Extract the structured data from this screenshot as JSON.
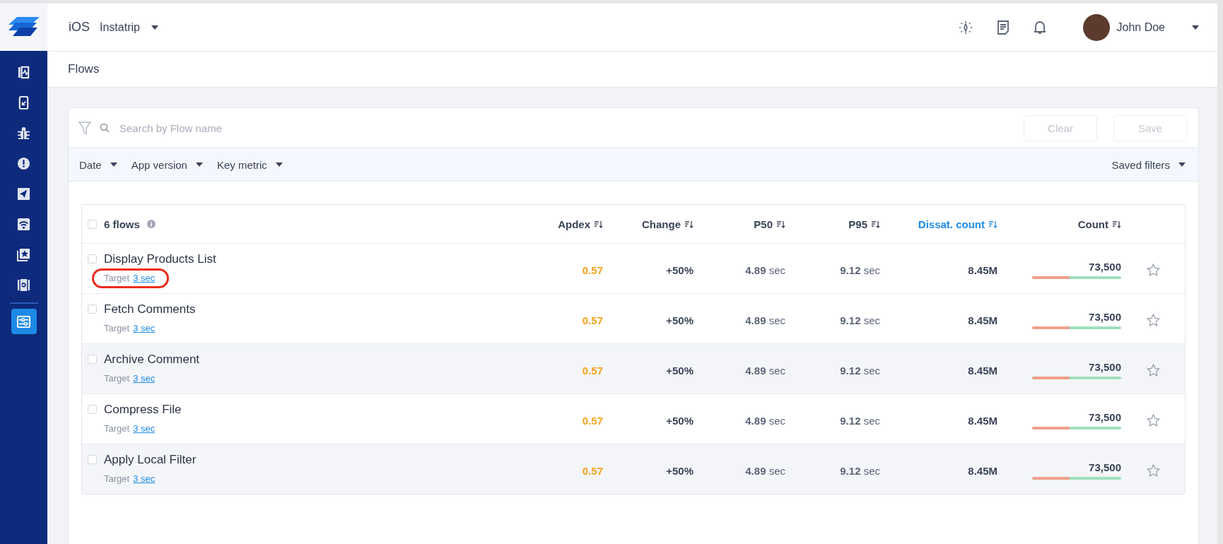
{
  "app": {
    "platform": "iOS",
    "name": "Instatrip"
  },
  "user": {
    "name": "John Doe"
  },
  "sidebar": {
    "items": [
      {
        "kind": "vitals",
        "selected": false
      },
      {
        "kind": "devices",
        "selected": false
      },
      {
        "kind": "bugs",
        "selected": false
      },
      {
        "kind": "crashes",
        "selected": false
      },
      {
        "kind": "releases",
        "selected": false
      },
      {
        "kind": "network",
        "selected": false
      },
      {
        "kind": "reviews",
        "selected": false
      },
      {
        "kind": "replay",
        "selected": false
      },
      {
        "kind": "flows",
        "selected": true
      }
    ]
  },
  "page_title": "Flows",
  "filters": {
    "search": {
      "placeholder": "Search by Flow name"
    },
    "buttons": [
      {
        "label": "Clear",
        "disabled": true
      },
      {
        "label": "Save",
        "disabled": true
      }
    ],
    "dropdowns": [
      "Date",
      "App version",
      "Key metric"
    ],
    "saved_filters": "Saved filters"
  },
  "table": {
    "count_label": "6 flows",
    "all_checked": false,
    "columns": [
      {
        "label": "Apdex",
        "sorted": false
      },
      {
        "label": "Change",
        "sorted": false
      },
      {
        "label": "P50",
        "sorted": false
      },
      {
        "label": "P95",
        "sorted": false
      },
      {
        "label": "Dissat. count",
        "sorted": true
      },
      {
        "label": "Count",
        "sorted": false
      }
    ],
    "rows": [
      {
        "name": "Display Products List",
        "target_label": "Target",
        "target": "3 sec",
        "circled": true,
        "checked": false,
        "hovered": false,
        "apdex": "0.57",
        "change": "+50%",
        "p50": "**4.89** sec",
        "p95": "**9.12** sec",
        "dissat": "8.45M",
        "count": "73,500",
        "level": 0.42,
        "starred": false
      },
      {
        "name": "Fetch Comments",
        "target_label": "Target",
        "target": "3 sec",
        "circled": false,
        "checked": false,
        "hovered": false,
        "apdex": "0.57",
        "change": "+50%",
        "p50": "**4.89** sec",
        "p95": "**9.12** sec",
        "dissat": "8.45M",
        "count": "73,500",
        "level": 0.42,
        "starred": false
      },
      {
        "name": "Archive Comment",
        "target_label": "Target",
        "target": "3 sec",
        "circled": false,
        "checked": false,
        "hovered": true,
        "apdex": "0.57",
        "change": "+50%",
        "p50": "**4.89** sec",
        "p95": "**9.12** sec",
        "dissat": "8.45M",
        "count": "73,500",
        "level": 0.42,
        "starred": false
      },
      {
        "name": "Compress File",
        "target_label": "Target",
        "target": "3 sec",
        "circled": false,
        "checked": false,
        "hovered": false,
        "apdex": "0.57",
        "change": "+50%",
        "p50": "**4.89** sec",
        "p95": "**9.12** sec",
        "dissat": "8.45M",
        "count": "73,500",
        "level": 0.42,
        "starred": false
      },
      {
        "name": "Apply Local Filter",
        "target_label": "Target",
        "target": "3 sec",
        "circled": false,
        "checked": false,
        "hovered": true,
        "apdex": "0.57",
        "change": "+50%",
        "p50": "**4.89** sec",
        "p95": "**9.12** sec",
        "dissat": "8.45M",
        "count": "73,500",
        "level": 0.42,
        "starred": false
      }
    ]
  }
}
